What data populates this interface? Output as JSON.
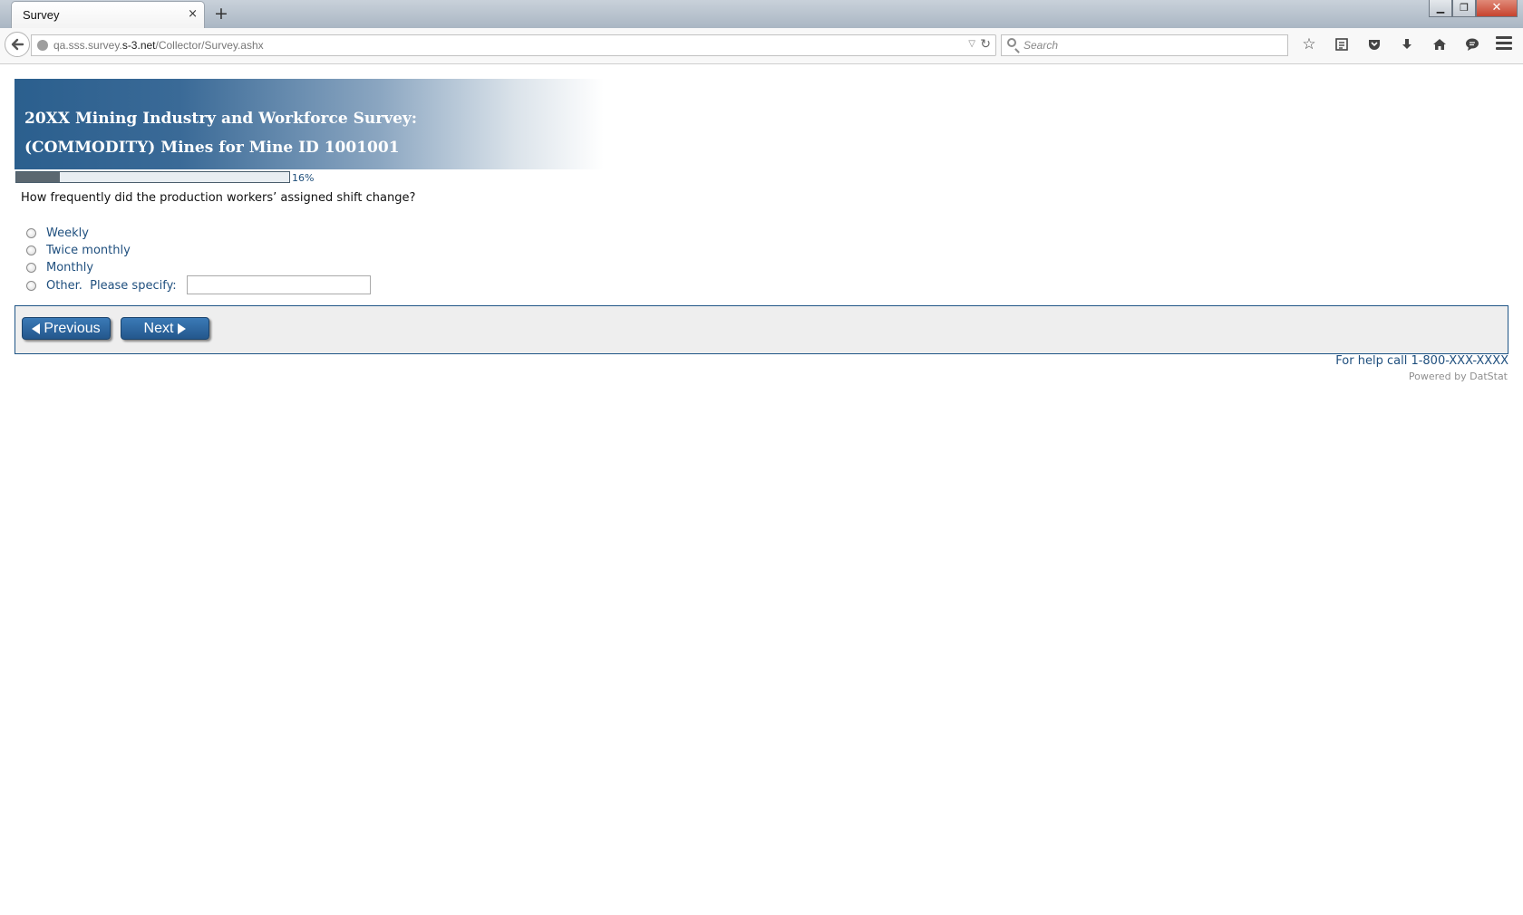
{
  "browser": {
    "tab_title": "Survey",
    "tab_close": "×",
    "new_tab": "+",
    "url_prefix": "qa.sss.survey.",
    "url_domain": "s-3.net",
    "url_path": "/Collector/Survey.ashx",
    "search_placeholder": "Search",
    "window_minimize": "▁",
    "window_restore": "❐",
    "window_close": "✕",
    "toolbar_icons": [
      "bookmark-star-icon",
      "reading-list-icon",
      "pocket-icon",
      "download-icon",
      "home-icon",
      "chat-icon",
      "menu-icon"
    ]
  },
  "survey": {
    "title_line1": "20XX Mining Industry and Workforce Survey:",
    "title_line2": "(COMMODITY) Mines for Mine ID 1001001",
    "progress_percent": 16,
    "progress_label": "16%",
    "question": "How frequently did the production workers’ assigned shift change?",
    "options": [
      {
        "label": "Weekly"
      },
      {
        "label": "Twice monthly"
      },
      {
        "label": "Monthly"
      },
      {
        "label": "Other.  Please specify:"
      }
    ],
    "specify_value": ""
  },
  "navigation": {
    "previous_label": "Previous",
    "next_label": "Next"
  },
  "footer": {
    "help_text": "For help call 1-800-XXX-XXXX",
    "powered_by": "Powered by DatStat"
  },
  "colors": {
    "accent": "#24578c",
    "link_text": "#1f4f7e",
    "panel_bg": "#eeeeee"
  }
}
